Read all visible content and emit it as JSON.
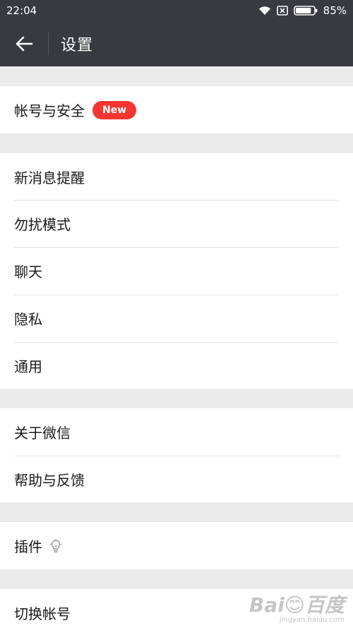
{
  "status_bar": {
    "time": "22:04",
    "battery_percent": "85%",
    "battery_level": 0.85,
    "icons": [
      "wifi-icon",
      "sim-blocked-icon",
      "battery-icon"
    ]
  },
  "toolbar": {
    "back_icon": "arrow-left-icon",
    "title": "设置"
  },
  "sections": {
    "account": {
      "items": [
        {
          "label": "帐号与安全",
          "badge": "New"
        }
      ]
    },
    "main": {
      "items": [
        {
          "label": "新消息提醒"
        },
        {
          "label": "勿扰模式"
        },
        {
          "label": "聊天"
        },
        {
          "label": "隐私"
        },
        {
          "label": "通用"
        }
      ]
    },
    "about": {
      "items": [
        {
          "label": "关于微信"
        },
        {
          "label": "帮助与反馈"
        }
      ]
    },
    "plugins": {
      "items": [
        {
          "label": "插件",
          "icon": "lightbulb-icon"
        }
      ]
    },
    "switch": {
      "items": [
        {
          "label": "切换帐号"
        }
      ]
    }
  },
  "watermark": {
    "logo": "Bai😊百度",
    "url": "jingyan.baidu.com"
  },
  "colors": {
    "header_bg": "#393a3f",
    "page_bg": "#ebebeb",
    "badge_red": "#f43531",
    "text": "#1a1a1a"
  }
}
